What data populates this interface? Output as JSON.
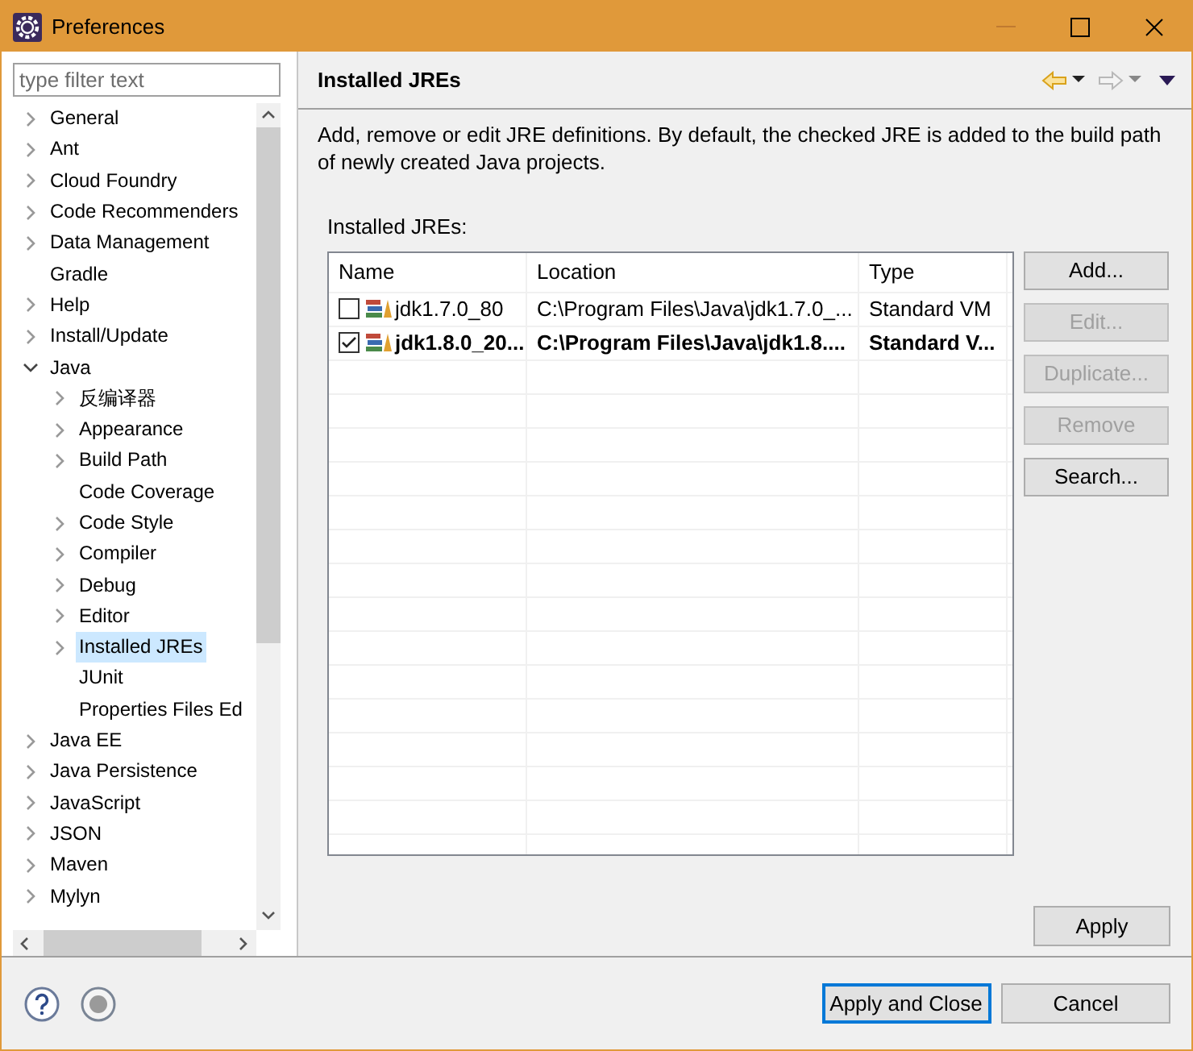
{
  "window": {
    "title": "Preferences"
  },
  "filter": {
    "placeholder": "type filter text"
  },
  "tree": [
    {
      "label": "General",
      "kind": "folder",
      "expanded": false,
      "selected": false
    },
    {
      "label": "Ant",
      "kind": "folder",
      "expanded": false,
      "selected": false
    },
    {
      "label": "Cloud Foundry",
      "kind": "folder",
      "expanded": false,
      "selected": false
    },
    {
      "label": "Code Recommenders",
      "kind": "folder",
      "expanded": false,
      "selected": false
    },
    {
      "label": "Data Management",
      "kind": "folder",
      "expanded": false,
      "selected": false
    },
    {
      "label": "Gradle",
      "kind": "leaf",
      "selected": false
    },
    {
      "label": "Help",
      "kind": "folder",
      "expanded": false,
      "selected": false
    },
    {
      "label": "Install/Update",
      "kind": "folder",
      "expanded": false,
      "selected": false
    },
    {
      "label": "Java",
      "kind": "folder",
      "expanded": true,
      "selected": false,
      "children": [
        {
          "label": "反编译器",
          "kind": "folder",
          "expanded": false,
          "selected": false
        },
        {
          "label": "Appearance",
          "kind": "folder",
          "expanded": false,
          "selected": false
        },
        {
          "label": "Build Path",
          "kind": "folder",
          "expanded": false,
          "selected": false
        },
        {
          "label": "Code Coverage",
          "kind": "leaf",
          "selected": false
        },
        {
          "label": "Code Style",
          "kind": "folder",
          "expanded": false,
          "selected": false
        },
        {
          "label": "Compiler",
          "kind": "folder",
          "expanded": false,
          "selected": false
        },
        {
          "label": "Debug",
          "kind": "folder",
          "expanded": false,
          "selected": false
        },
        {
          "label": "Editor",
          "kind": "folder",
          "expanded": false,
          "selected": false
        },
        {
          "label": "Installed JREs",
          "kind": "folder",
          "expanded": false,
          "selected": true
        },
        {
          "label": "JUnit",
          "kind": "leaf",
          "selected": false
        },
        {
          "label": "Properties Files Ed",
          "kind": "leaf",
          "selected": false
        }
      ]
    },
    {
      "label": "Java EE",
      "kind": "folder",
      "expanded": false,
      "selected": false
    },
    {
      "label": "Java Persistence",
      "kind": "folder",
      "expanded": false,
      "selected": false
    },
    {
      "label": "JavaScript",
      "kind": "folder",
      "expanded": false,
      "selected": false
    },
    {
      "label": "JSON",
      "kind": "folder",
      "expanded": false,
      "selected": false
    },
    {
      "label": "Maven",
      "kind": "folder",
      "expanded": false,
      "selected": false
    },
    {
      "label": "Mylyn",
      "kind": "folder",
      "expanded": false,
      "selected": false
    }
  ],
  "page": {
    "title": "Installed JREs",
    "description": "Add, remove or edit JRE definitions. By default, the checked JRE is added to the build path of newly created Java projects.",
    "table_label": "Installed JREs:"
  },
  "table": {
    "columns": [
      "Name",
      "Location",
      "Type"
    ],
    "rows": [
      {
        "checked": false,
        "cells": [
          "jdk1.7.0_80",
          "C:\\Program Files\\Java\\jdk1.7.0_...",
          "Standard VM"
        ]
      },
      {
        "checked": true,
        "cells": [
          "jdk1.8.0_20...",
          "C:\\Program Files\\Java\\jdk1.8....",
          "Standard V..."
        ]
      }
    ]
  },
  "side_buttons": [
    {
      "label": "Add...",
      "disabled": false
    },
    {
      "label": "Edit...",
      "disabled": true
    },
    {
      "label": "Duplicate...",
      "disabled": true
    },
    {
      "label": "Remove",
      "disabled": true
    },
    {
      "label": "Search...",
      "disabled": false
    }
  ],
  "apply_button": {
    "label": "Apply"
  },
  "footer_buttons": [
    {
      "label": "Apply and Close",
      "default": true
    },
    {
      "label": "Cancel",
      "default": false
    }
  ]
}
